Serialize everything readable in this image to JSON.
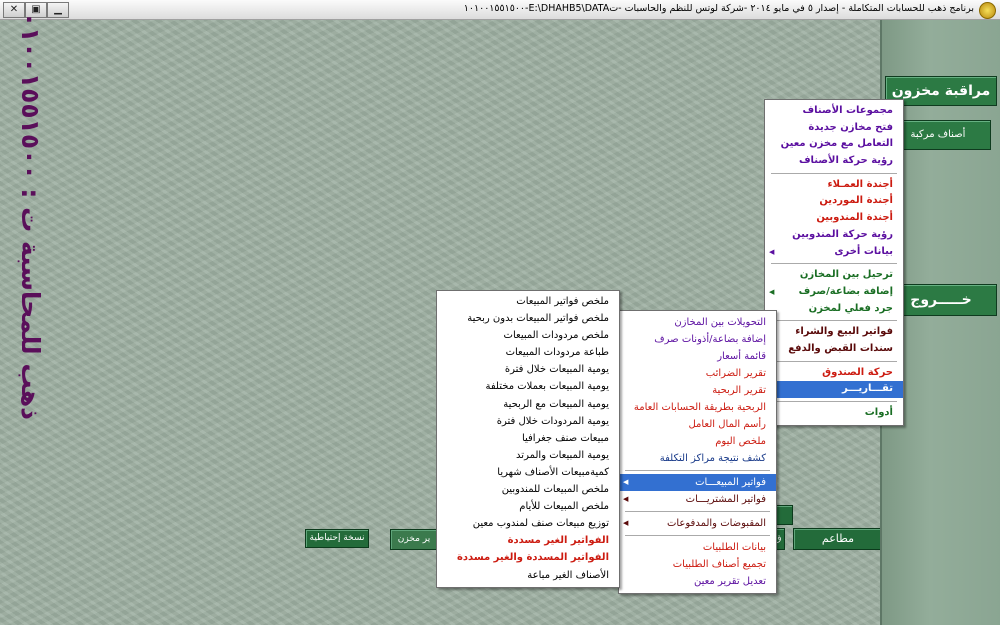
{
  "window": {
    "title": "برنامج ذهب للحسابات المتكاملة - إصدار ٥ في   مايو ٢٠١٤ -شركة لوتس للنظم والحاسبات -تE:\\DHAHB5\\DATA-١٠١٠٠١٥٥١٥٠٠",
    "minimize": "▁",
    "maximize": "▣",
    "close": "✕"
  },
  "branding": {
    "vertical_title": "ذهب للمحاسبة ت : ٠١٠٠١٥٥١٥٠٠"
  },
  "buttons": {
    "inventory": "مراقبة مخزون",
    "composite_items": "أصناف مركبة",
    "exit": "خـــــروج",
    "backup": "نسخة إحتياطية",
    "store_partial": "ير مخزن",
    "restaurants": "مطاعم",
    "hidden_small": "ق"
  },
  "main_menu": {
    "items": [
      {
        "label": "مجموعات الأصناف",
        "color": "#5b0fa0",
        "arrow": false
      },
      {
        "label": "فتح مخازن جديدة",
        "color": "#5b0fa0",
        "arrow": false
      },
      {
        "label": "التعامل مع مخزن معين",
        "color": "#5b0fa0",
        "arrow": false
      },
      {
        "label": "رؤية حركة الأصناف",
        "color": "#5b0fa0",
        "arrow": false
      },
      {
        "label": "أجندة العمـلاء",
        "color": "#cc1b10",
        "arrow": false,
        "sep_before": true
      },
      {
        "label": "أجندة الموردين",
        "color": "#cc1b10",
        "arrow": false
      },
      {
        "label": "أجندة المندوبين",
        "color": "#cc1b10",
        "arrow": false
      },
      {
        "label": "رؤية حركة المندوبين",
        "color": "#5b0fa0",
        "arrow": false
      },
      {
        "label": "بيانات أخرى",
        "color": "#5b0fa0",
        "arrow": true
      },
      {
        "label": "ترحيل بين المخازن",
        "color": "#1a6e24",
        "arrow": false,
        "sep_before": true
      },
      {
        "label": "إضافة بضاعة/صرف",
        "color": "#1a6e24",
        "arrow": true
      },
      {
        "label": "جرد فعلي لمخزن",
        "color": "#1a6e24",
        "arrow": false
      },
      {
        "label": "فواتير البيع والشراء",
        "color": "#5a0a0a",
        "arrow": true,
        "sep_before": true
      },
      {
        "label": "سندات القبض والدفع",
        "color": "#5a0a0a",
        "arrow": true
      },
      {
        "label": "حركة الصندوق",
        "color": "#cc1b10",
        "arrow": false,
        "sep_before": true
      },
      {
        "label": "تقـــاريـــر",
        "color": "#ffffff",
        "arrow": true,
        "highlight": true
      },
      {
        "label": "أدوات",
        "color": "#1a6e24",
        "arrow": true,
        "sep_before": true
      }
    ]
  },
  "reports_menu": {
    "items": [
      {
        "label": "التحويلات بين المخازن",
        "color": "#5b0fa0",
        "arrow": false
      },
      {
        "label": "إضافة بضاعة/أذونات صرف",
        "color": "#5b0fa0",
        "arrow": false
      },
      {
        "label": "قائمة أسعار",
        "color": "#5b0fa0",
        "arrow": false
      },
      {
        "label": "تقرير الضرائب",
        "color": "#cc1b10",
        "arrow": false
      },
      {
        "label": "تقرير الربحية",
        "color": "#cc1b10",
        "arrow": false
      },
      {
        "label": "الربحية بطريقة الحسابات العامة",
        "color": "#cc1b10",
        "arrow": false
      },
      {
        "label": "رأسم المال العامل",
        "color": "#cc1b10",
        "arrow": false
      },
      {
        "label": "ملخص اليوم",
        "color": "#cc1b10",
        "arrow": false
      },
      {
        "label": "كشف نتيجة مراكز التكلفة",
        "color": "#1a3b8a",
        "arrow": false
      },
      {
        "label": "فواتير المبيعـــات",
        "color": "#ffffff",
        "arrow": true,
        "highlight": true,
        "sep_before": true
      },
      {
        "label": "فواتير المشتريـــات",
        "color": "#5a0a0a",
        "arrow": true
      },
      {
        "label": "المقبوضات والمدفوعات",
        "color": "#5a0a0a",
        "arrow": true,
        "sep_before": true
      },
      {
        "label": "بيانات الطلبيات",
        "color": "#cc1b10",
        "arrow": false,
        "sep_before": true
      },
      {
        "label": "تجميع أصناف الطلبيات",
        "color": "#cc1b10",
        "arrow": false
      },
      {
        "label": "تعديل تقرير معين",
        "color": "#5b0fa0",
        "arrow": false
      }
    ]
  },
  "sales_menu": {
    "items": [
      {
        "label": "ملخص فواتير المبيعات",
        "color": "#000000",
        "bold": false
      },
      {
        "label": "ملخص فواتير المبيعات بدون ربحية",
        "color": "#000000",
        "bold": false
      },
      {
        "label": "ملخص مردودات المبيعات",
        "color": "#000000",
        "bold": false
      },
      {
        "label": "طباعة مردودات المبيعات",
        "color": "#000000",
        "bold": false
      },
      {
        "label": "يومية المبيعات خلال فترة",
        "color": "#000000",
        "bold": false
      },
      {
        "label": "يومية  المبيعات بعملات مختلفة",
        "color": "#000000",
        "bold": false
      },
      {
        "label": "يومية المبيعات مع الربحية",
        "color": "#000000",
        "bold": false
      },
      {
        "label": "يومية  المردودات خلال فترة",
        "color": "#000000",
        "bold": false
      },
      {
        "label": "مبيعات صنف جغرافيا",
        "color": "#000000",
        "bold": false
      },
      {
        "label": "يومية المبيعات والمرتد",
        "color": "#000000",
        "bold": false
      },
      {
        "label": "كميةمبيعات الأصناف شهريا",
        "color": "#000000",
        "bold": false
      },
      {
        "label": "ملخص المبيعات للمندوبين",
        "color": "#000000",
        "bold": false
      },
      {
        "label": "ملخص المبيعات للأيام",
        "color": "#000000",
        "bold": false
      },
      {
        "label": "توزيع مبيعات صنف لمندوب معين",
        "color": "#000000",
        "bold": false
      },
      {
        "label": "الفواتير الغير مسددة",
        "color": "#cc1b10",
        "bold": true
      },
      {
        "label": "الفواتير المسددة والغير مسددة",
        "color": "#cc1b10",
        "bold": true
      },
      {
        "label": "الأصناف الغير مباعة",
        "color": "#000000",
        "bold": false
      }
    ]
  },
  "colors": {
    "desktop": "#9eb0a2",
    "title_brand": "#5a0f5a",
    "button_green": "#236b3a",
    "menu_highlight": "#3370d1"
  }
}
